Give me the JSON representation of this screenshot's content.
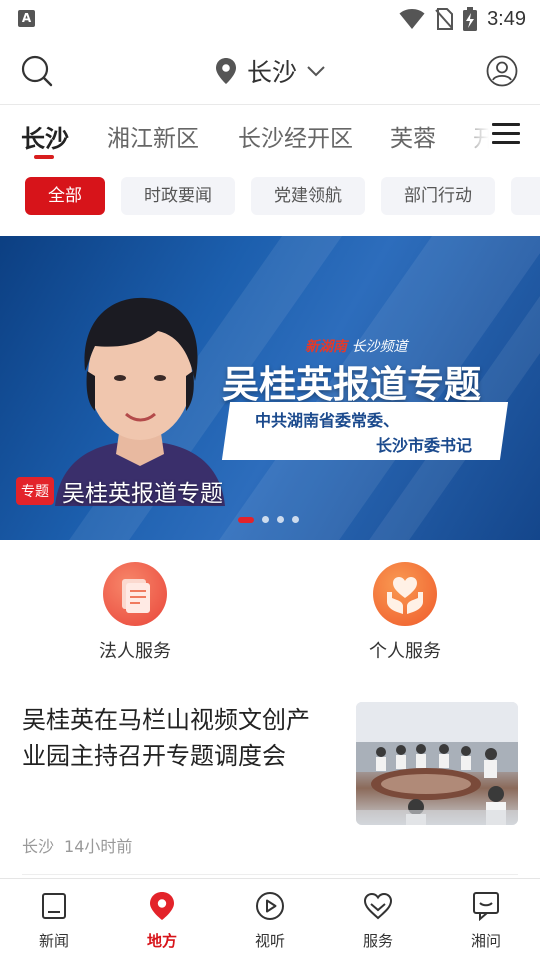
{
  "status_bar": {
    "app_badge": "A",
    "time": "3:49"
  },
  "header": {
    "location": "长沙"
  },
  "channel_tabs": [
    "长沙",
    "湘江新区",
    "长沙经开区",
    "芙蓉",
    "开"
  ],
  "filters": [
    "全部",
    "时政要闻",
    "党建领航",
    "部门行动",
    ""
  ],
  "banner": {
    "brand": "新湖南",
    "brand_suffix": "长沙频道",
    "headline": "吴桂英报道专题",
    "subtitle_line1": "中共湖南省委常委、",
    "subtitle_line2": "长沙市委书记",
    "badge": "专题",
    "caption": "吴桂英报道专题",
    "slide_count": 4,
    "active_slide": 1
  },
  "services": [
    {
      "label": "法人服务",
      "icon": "document-icon"
    },
    {
      "label": "个人服务",
      "icon": "heart-hands-icon"
    }
  ],
  "article": {
    "title": "吴桂英在马栏山视频文创产业园主持召开专题调度会",
    "source": "长沙",
    "time": "14小时前"
  },
  "bottom_nav": [
    {
      "label": "新闻",
      "icon": "news-icon"
    },
    {
      "label": "地方",
      "icon": "location-icon"
    },
    {
      "label": "视听",
      "icon": "play-icon"
    },
    {
      "label": "服务",
      "icon": "heart-service-icon"
    },
    {
      "label": "湘问",
      "icon": "chat-icon"
    }
  ],
  "colors": {
    "accent": "#d7141a",
    "banner_blue": "#1c5fae",
    "service_orange": "#f06a3c"
  }
}
